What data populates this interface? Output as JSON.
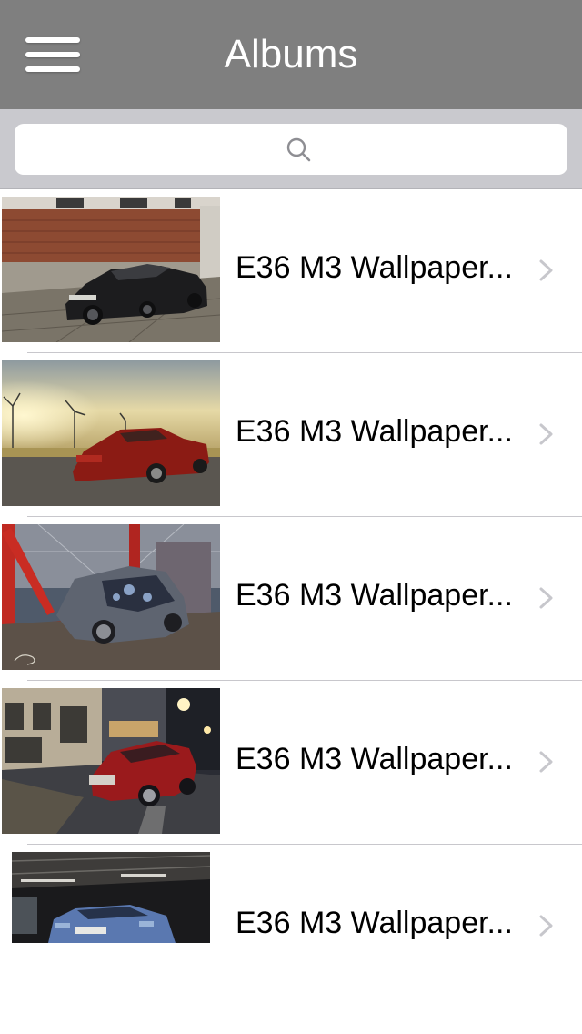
{
  "header": {
    "title": "Albums"
  },
  "search": {
    "placeholder": ""
  },
  "albums": [
    {
      "title": "E36 M3 Wallpaper..."
    },
    {
      "title": "E36 M3 Wallpaper..."
    },
    {
      "title": "E36 M3 Wallpaper..."
    },
    {
      "title": "E36 M3 Wallpaper..."
    },
    {
      "title": "E36 M3 Wallpaper..."
    }
  ],
  "icons": {
    "menu": "hamburger-menu-icon",
    "search": "search-icon",
    "disclosure": "chevron-right-icon"
  },
  "colors": {
    "navbar": "#7f7f7f",
    "searchbar_bg": "#c9c9ce",
    "chevron": "#c7c7cc",
    "separator": "#c8c7cc"
  }
}
